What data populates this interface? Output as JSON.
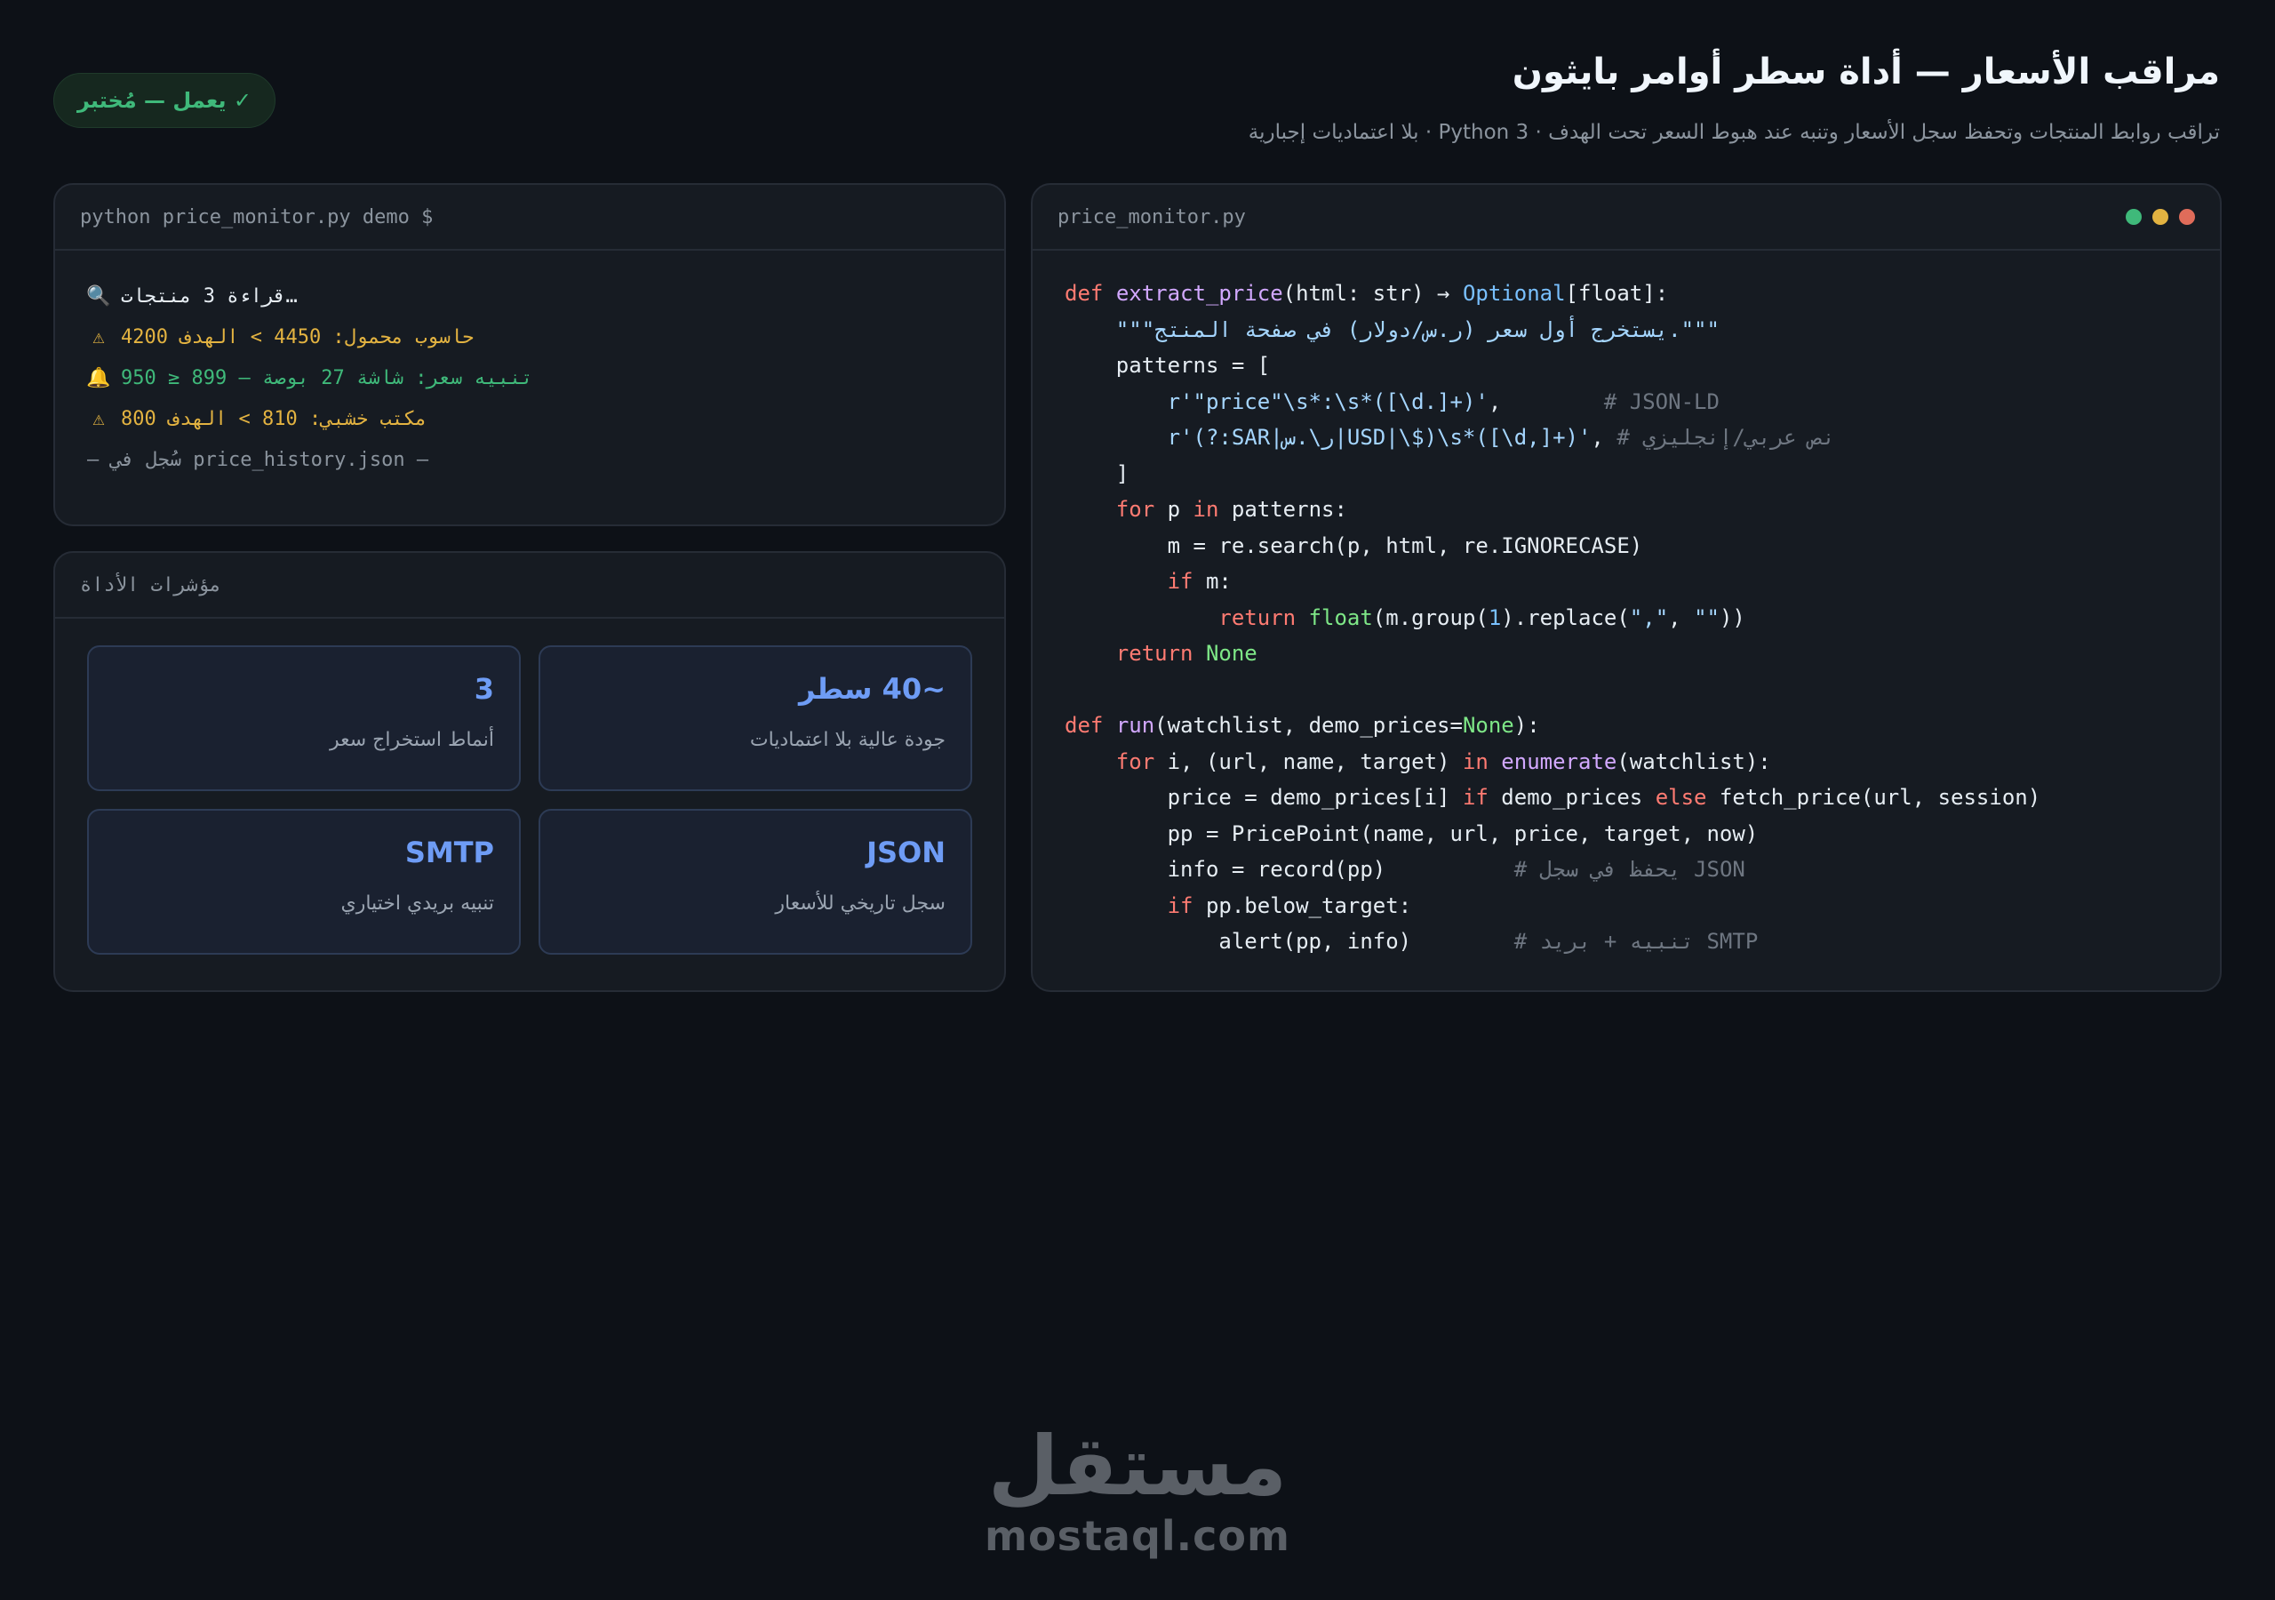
{
  "header": {
    "title": "مراقب الأسعار — أداة سطر أوامر بايثون",
    "subtitle": "تراقب روابط المنتجات وتحفظ سجل الأسعار وتنبه عند هبوط السعر تحت الهدف · Python 3 · بلا اعتماديات إجبارية",
    "badge": "✓ يعمل — مُختبر"
  },
  "terminal": {
    "header": "python price_monitor.py demo $",
    "lines": [
      {
        "icon": "magnifier-icon",
        "glyph": "🔍",
        "text": "قراءة 3 منتجات…",
        "color": "white"
      },
      {
        "icon": "warning-icon",
        "glyph": "⚠",
        "text": "حاسوب محمول: 4450 > الهدف 4200",
        "color": "yellow"
      },
      {
        "icon": "bell-icon",
        "glyph": "🔔",
        "text": "تنبيه سعر: شاشة 27 بوصة — 899 ≤ 950",
        "color": "green"
      },
      {
        "icon": "warning-icon",
        "glyph": "⚠",
        "text": "مكتب خشبي: 810 > الهدف 800",
        "color": "yellow"
      },
      {
        "icon": "",
        "glyph": "",
        "text": "— سُجل في price_history.json —",
        "color": "gray"
      }
    ]
  },
  "metrics": {
    "header": "مؤشرات الأداة",
    "cards": [
      {
        "value": "~40 سطر",
        "label": "جودة عالية بلا اعتماديات"
      },
      {
        "value": "3",
        "label": "أنماط استخراج سعر"
      },
      {
        "value": "JSON",
        "label": "سجل تاريخي للأسعار"
      },
      {
        "value": "SMTP",
        "label": "تنبيه بريدي اختياري"
      }
    ]
  },
  "editor": {
    "filename": "price_monitor.py",
    "dots": [
      "#3fb97a",
      "#e3b341",
      "#e06c5a"
    ]
  },
  "footer": {
    "logo_ar": "مستقل",
    "logo_en": "mostaql.com"
  }
}
